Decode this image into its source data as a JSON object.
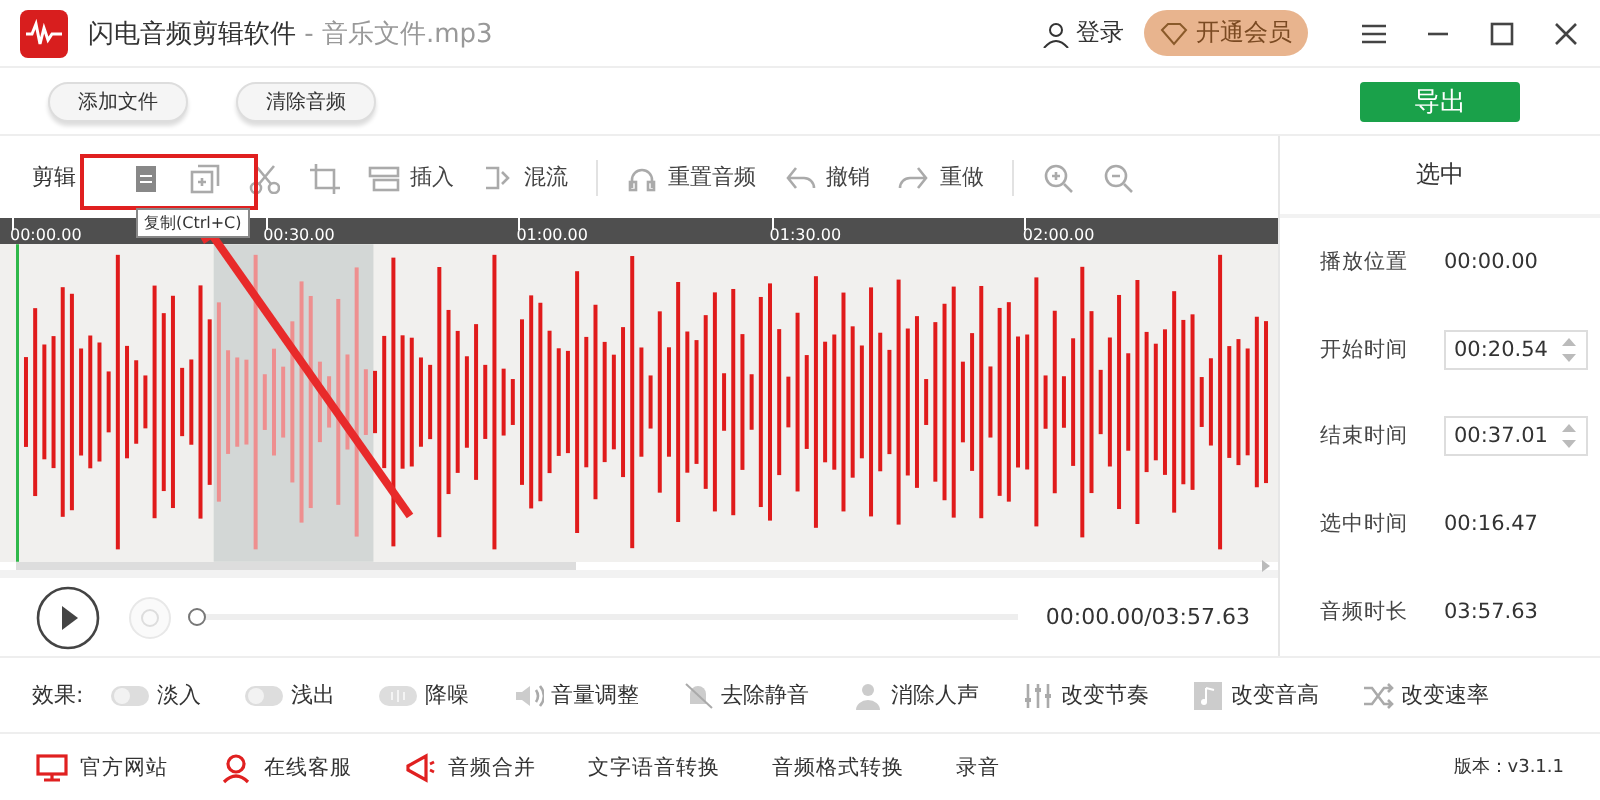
{
  "window": {
    "app_title": "闪电音频剪辑软件",
    "file_title": " - 音乐文件.mp3",
    "login": "登录",
    "vip": "开通会员"
  },
  "top_buttons": [
    "添加文件",
    "清除音频"
  ],
  "export_button": "导出",
  "edit_toolbar": {
    "label": "剪辑",
    "items": [
      {
        "kind": "icon"
      },
      {
        "kind": "icon"
      },
      {
        "kind": "icon"
      },
      {
        "kind": "icon"
      },
      {
        "kind": "labeled",
        "label": "插入"
      },
      {
        "kind": "labeled",
        "label": "混流"
      },
      {
        "kind": "sep"
      },
      {
        "kind": "labeled",
        "label": "重置音频"
      },
      {
        "kind": "labeled",
        "label": "撤销"
      },
      {
        "kind": "labeled",
        "label": "重做"
      },
      {
        "kind": "sep"
      },
      {
        "kind": "icon"
      },
      {
        "kind": "icon"
      }
    ]
  },
  "tooltip": "复制(Ctrl+C)",
  "timeline": {
    "ticks": [
      "00:00.00",
      "00:30.00",
      "01:00.00",
      "01:30.00",
      "02:00.00"
    ]
  },
  "player": {
    "level": 0,
    "time": "00:00.00/03:57.63"
  },
  "side_panel": {
    "title": "选中",
    "rows": [
      {
        "kind": "text",
        "label": "播放位置",
        "value": "00:00.00"
      },
      {
        "kind": "spin",
        "label": "开始时间",
        "value": "00:20.54"
      },
      {
        "kind": "spin",
        "label": "结束时间",
        "value": "00:37.01"
      },
      {
        "kind": "text",
        "label": "选中时间",
        "value": "00:16.47"
      },
      {
        "kind": "text",
        "label": "音频时长",
        "value": "03:57.63"
      }
    ]
  },
  "effects": {
    "label": "效果:",
    "items": [
      {
        "label": "淡入"
      },
      {
        "label": "浅出"
      },
      {
        "label": "降噪"
      },
      {
        "label": "音量调整"
      },
      {
        "label": "去除静音"
      },
      {
        "label": "消除人声"
      },
      {
        "label": "改变节奏"
      },
      {
        "label": "改变音高"
      },
      {
        "label": "改变速率"
      }
    ]
  },
  "bottom_bar": {
    "items": [
      {
        "label": "官方网站"
      },
      {
        "label": "在线客服"
      },
      {
        "label": "音频合并"
      },
      {
        "label": "文字语音转换"
      },
      {
        "label": "音频格式转换"
      },
      {
        "label": "录音"
      }
    ],
    "version": "版本：v3.1.1"
  }
}
